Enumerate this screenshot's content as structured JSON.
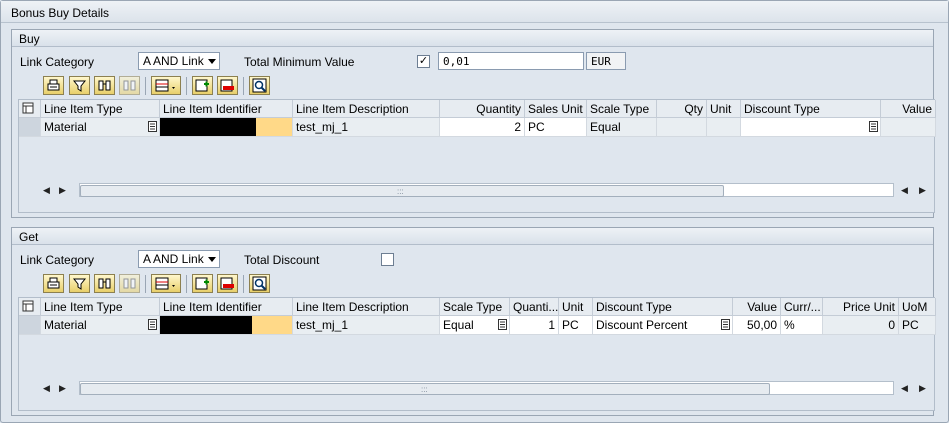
{
  "frame_title": "Bonus Buy Details",
  "buy": {
    "title": "Buy",
    "link_category_label": "Link Category",
    "link_category_value": "A AND Link",
    "total_min_label": "Total Minimum Value",
    "total_min_checked": true,
    "total_min_value": "0,01",
    "currency": "EUR",
    "columns": [
      "Line Item Type",
      "Line Item Identifier",
      "Line Item Description",
      "Quantity",
      "Sales Unit",
      "Scale Type",
      "Qty",
      "Unit",
      "Discount Type",
      "Value"
    ],
    "row": {
      "type": "Material",
      "identifier": "",
      "description": "test_mj_1",
      "quantity": "2",
      "sales_unit": "PC",
      "scale_type": "Equal",
      "qty": "",
      "unit": "",
      "discount_type": "",
      "value": ""
    }
  },
  "get": {
    "title": "Get",
    "link_category_label": "Link Category",
    "link_category_value": "A AND Link",
    "total_discount_label": "Total Discount",
    "total_discount_checked": false,
    "columns": [
      "Line Item Type",
      "Line Item Identifier",
      "Line Item Description",
      "Scale Type",
      "Quanti...",
      "Unit",
      "Discount Type",
      "Value",
      "Curr/...",
      "Price Unit",
      "UoM"
    ],
    "row": {
      "type": "Material",
      "identifier": "",
      "description": "test_mj_1",
      "scale_type": "Equal",
      "quantity": "1",
      "unit": "PC",
      "discount_type": "Discount Percent",
      "value": "50,00",
      "currency": "%",
      "price_unit": "0",
      "uom": "PC"
    }
  },
  "icons": [
    "print-icon",
    "filter-icon",
    "find-icon",
    "find-next-icon",
    "layout-icon",
    "insert-row-icon",
    "delete-row-icon",
    "details-icon"
  ],
  "colors": {
    "accent_yellow": "#ffd988",
    "redacted": "#000000",
    "background": "#dfe6ee"
  }
}
